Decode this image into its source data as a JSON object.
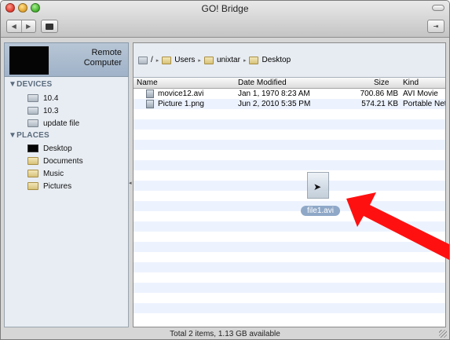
{
  "window": {
    "title": "GO! Bridge"
  },
  "sidebar": {
    "remote_label_line1": "Remote",
    "remote_label_line2": "Computer",
    "devices_header": "▼DEVICES",
    "devices": [
      {
        "label": "10.4"
      },
      {
        "label": "10.3"
      },
      {
        "label": "update file"
      }
    ],
    "places_header": "▼PLACES",
    "places": [
      {
        "label": "Desktop"
      },
      {
        "label": "Documents"
      },
      {
        "label": "Music"
      },
      {
        "label": "Pictures"
      }
    ]
  },
  "path": {
    "root": "/",
    "segments": [
      "Users",
      "unixtar",
      "Desktop"
    ]
  },
  "table": {
    "columns": {
      "name": "Name",
      "date": "Date Modified",
      "size": "Size",
      "kind": "Kind"
    },
    "rows": [
      {
        "name": "movice12.avi",
        "date": "Jan 1, 1970 8:23 AM",
        "size": "700.86 MB",
        "kind": "AVI Movie"
      },
      {
        "name": "Picture 1.png",
        "date": "Jun 2, 2010 5:35 PM",
        "size": "574.21 KB",
        "kind": "Portable Netw..."
      }
    ]
  },
  "drag_item": {
    "label": "file1.avi"
  },
  "status": {
    "text": "Total 2 items, 1.13 GB available"
  },
  "colors": {
    "arrow": "#ff1010",
    "row_alt": "#edf3fe",
    "sidebar_bg": "#e8edf3"
  }
}
